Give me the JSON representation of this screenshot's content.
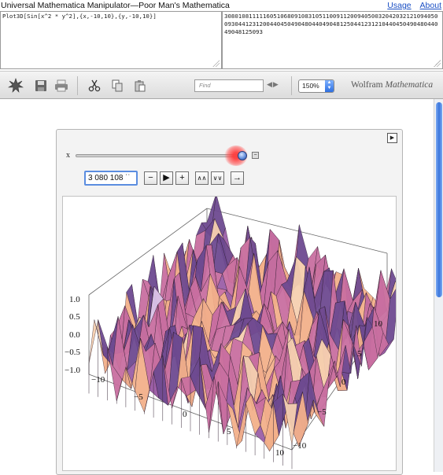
{
  "title_bar": {
    "title": "Universal Mathematica Manipulator—Poor Man's Mathematica",
    "links": [
      "Usage",
      "About"
    ]
  },
  "input_code": "Plot3D[Sin[x^2 * y^2],{x,-10,10},{y,-10,10}]",
  "encoded_output": "3080108111116051068091083105110091120094050032042032121094050093044123120044045049048044049048125044123121044045049048044049048125093",
  "toolbar": {
    "find_placeholder": "Find",
    "zoom": "150%",
    "brand_name": "Wolfram",
    "brand_product": "Mathematica",
    "icons": [
      "explosion-icon",
      "save-icon",
      "print-icon",
      "scissors-icon",
      "copy-icon",
      "paste-icon"
    ]
  },
  "manipulate": {
    "variable_label": "x",
    "value_display": "3 080 108 ˙˙",
    "slider_fraction": 0.99,
    "controls": [
      "−",
      "▶",
      "+",
      "∧∧",
      "∨∨",
      "→"
    ]
  },
  "plot": {
    "z_ticks": [
      "1.0",
      "0.5",
      "0.0",
      "−0.5",
      "−1.0"
    ],
    "x_ticks": [
      "−10",
      "−5",
      "0",
      "5",
      "10"
    ],
    "y_ticks": [
      "−10",
      "−5",
      "0",
      "5",
      "10"
    ],
    "surface_colors": [
      "#e87a9a",
      "#9b5fa8",
      "#f2b08a",
      "#c86fa0",
      "#6e4a90",
      "#f5d0b0",
      "#d9c3e8"
    ]
  }
}
